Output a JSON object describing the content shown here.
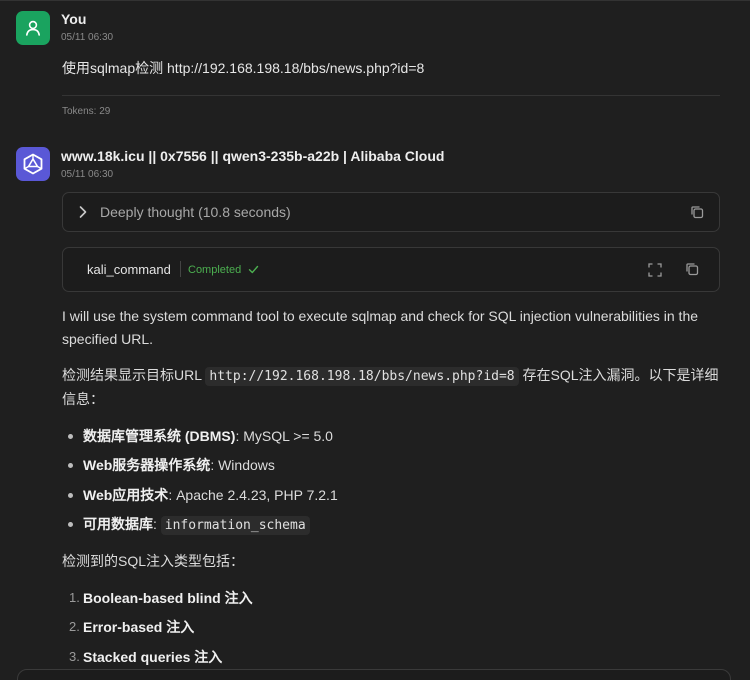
{
  "colors": {
    "background": "#1f1f1f",
    "user_avatar": "#1aa35f",
    "bot_avatar": "#5a58d6",
    "completed": "#4caf50"
  },
  "user_message": {
    "name": "You",
    "time": "05/11 06:30",
    "text": "使用sqlmap检测  http://192.168.198.18/bbs/news.php?id=8",
    "tokens": "Tokens: 29"
  },
  "bot_message": {
    "name": "www.18k.icu || 0x7556 || qwen3-235b-a22b | Alibaba Cloud",
    "time": "05/11 06:30",
    "thinking": "Deeply thought (10.8 seconds)",
    "tool": {
      "name": "kali_command",
      "status": "Completed"
    },
    "intro": "I will use the system command tool to execute sqlmap and check for SQL injection vulnerabilities in the specified URL.",
    "result_prefix": "检测结果显示目标URL",
    "result_url": "http://192.168.198.18/bbs/news.php?id=8",
    "result_suffix": "存在SQL注入漏洞。以下是详细信息：",
    "details": [
      {
        "label": "数据库管理系统 (DBMS)",
        "value": ": MySQL >= 5.0"
      },
      {
        "label": "Web服务器操作系统",
        "value": ": Windows"
      },
      {
        "label": "Web应用技术",
        "value": ": Apache 2.4.23, PHP 7.2.1"
      },
      {
        "label": "可用数据库",
        "value": ": ",
        "code": "information_schema"
      }
    ],
    "types_heading": "检测到的SQL注入类型包括：",
    "types": [
      {
        "num": "1.",
        "text": "Boolean-based blind 注入"
      },
      {
        "num": "2.",
        "text": "Error-based 注入"
      },
      {
        "num": "3.",
        "text": "Stacked queries 注入"
      }
    ]
  },
  "icons": {
    "user_avatar": "person-icon",
    "bot_avatar": "qwen-logo-icon",
    "chevron": "chevron-right-icon",
    "copy": "copy-icon",
    "expand": "expand-icon",
    "check": "check-icon"
  }
}
